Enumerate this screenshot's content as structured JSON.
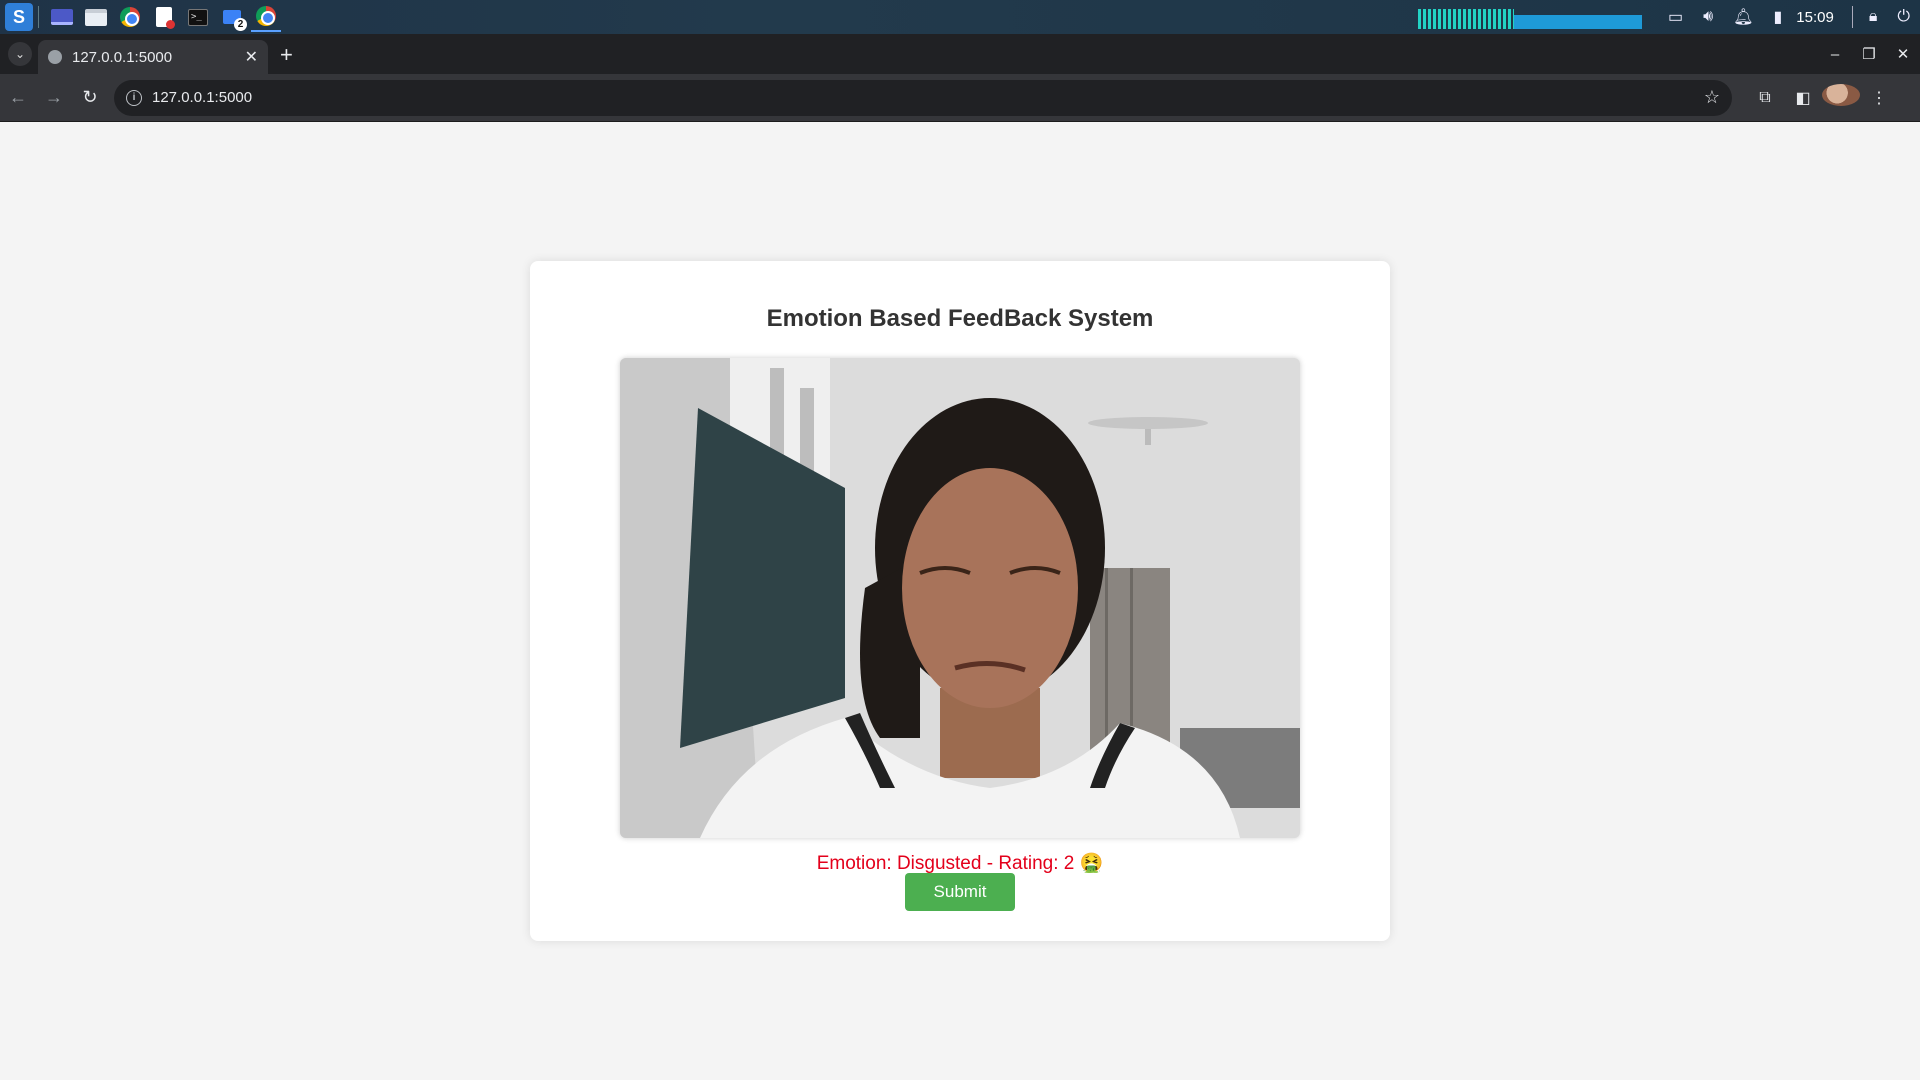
{
  "taskbar": {
    "workspace_badge": "2",
    "clock": "15:09"
  },
  "browser": {
    "tab_title": "127.0.0.1:5000",
    "tab_close": "✕",
    "new_tab": "+",
    "address": "127.0.0.1:5000",
    "window_controls": {
      "minimize": "–",
      "restore": "❐",
      "close": "✕"
    }
  },
  "page": {
    "title": "Emotion Based FeedBack System",
    "result_text": "Emotion: Disgusted - Rating: 2 🤮",
    "submit_label": "Submit",
    "video_alt": "webcam feed"
  },
  "colors": {
    "submit": "#4caf50",
    "result": "#e3001b",
    "card": "#ffffff",
    "background": "#f4f4f4"
  }
}
